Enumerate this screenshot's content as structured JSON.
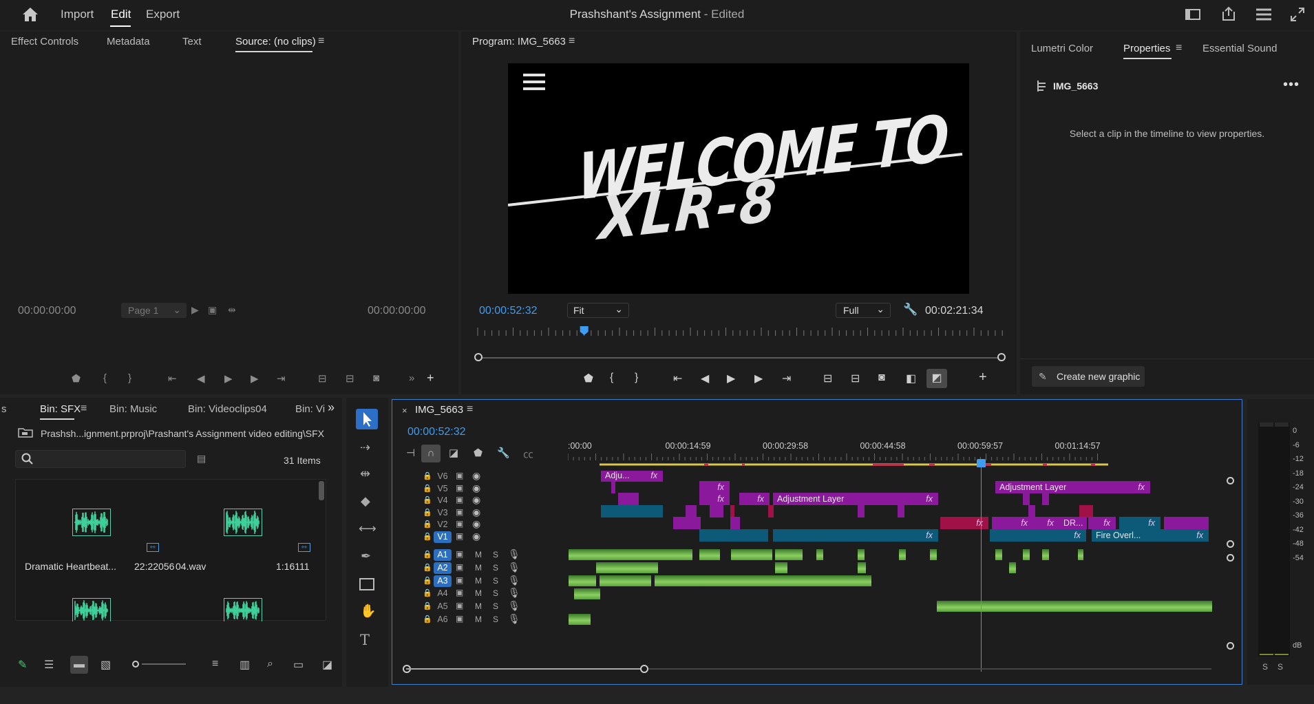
{
  "nav": {
    "items": [
      "Import",
      "Edit",
      "Export"
    ],
    "title": "Prashshant's Assignment",
    "title_suffix": " - Edited"
  },
  "source": {
    "tabs": [
      "Effect Controls",
      "Metadata",
      "Text",
      "Source: (no clips)"
    ],
    "timecode_left": "00:00:00:00",
    "timecode_right": "00:00:00:00",
    "page_select": "Page 1"
  },
  "program": {
    "tab": "Program: IMG_5663",
    "timecode": "00:00:52:32",
    "fit": "Fit",
    "quality": "Full",
    "duration": "00:02:21:34",
    "title_line1": "WELCOME TO",
    "title_line2": "XLR-8",
    "playhead_fraction": 0.37
  },
  "props": {
    "tabs": [
      "Lumetri Color",
      "Properties",
      "Essential Sound"
    ],
    "clip": "IMG_5663",
    "message": "Select a clip in the timeline to view properties.",
    "button": "Create new graphic"
  },
  "project": {
    "tabs": [
      "s",
      "Bin: SFX",
      "Bin: Music",
      "Bin: Videoclips04",
      "Bin: Vi"
    ],
    "path": "Prashsh...ignment.prproj\\Prashant's Assignment video editing\\SFX",
    "count": "31 Items",
    "items": [
      {
        "name": "Dramatic Heartbeat...",
        "duration": "22:22056"
      },
      {
        "name": "04.wav",
        "duration": "1:16111"
      }
    ]
  },
  "timeline": {
    "tab": "IMG_5663",
    "timecode": "00:00:52:32",
    "ruler": [
      ":00:00",
      "00:00:14:59",
      "00:00:29:58",
      "00:00:44:58",
      "00:00:59:57",
      "00:01:14:57"
    ],
    "video_tracks": [
      "V6",
      "V5",
      "V4",
      "V3",
      "V2",
      "V1"
    ],
    "audio_tracks": [
      "A1",
      "A2",
      "A3",
      "A4",
      "A5",
      "A6"
    ],
    "active_tracks": [
      "V1",
      "A1",
      "A2",
      "A3"
    ],
    "mute_label": "M",
    "solo_label": "S",
    "clip_labels": {
      "adj_short": "Adju...",
      "adj_layer": "Adjustment Layer",
      "dr": "DR...",
      "fire": "Fire Overl...",
      "fx": "fx"
    }
  },
  "meter": {
    "scale": [
      "0",
      "-6",
      "-12",
      "-18",
      "-24",
      "-30",
      "-36",
      "-42",
      "-48",
      "-54"
    ],
    "unit": "dB",
    "solo": [
      "S",
      "S"
    ]
  },
  "colors": {
    "accent": "#2d8ceb",
    "video_clip": "#8a1a9b",
    "teal_clip": "#0d5a78",
    "red_clip": "#a01247",
    "audio_clip": "#6fb64a"
  }
}
